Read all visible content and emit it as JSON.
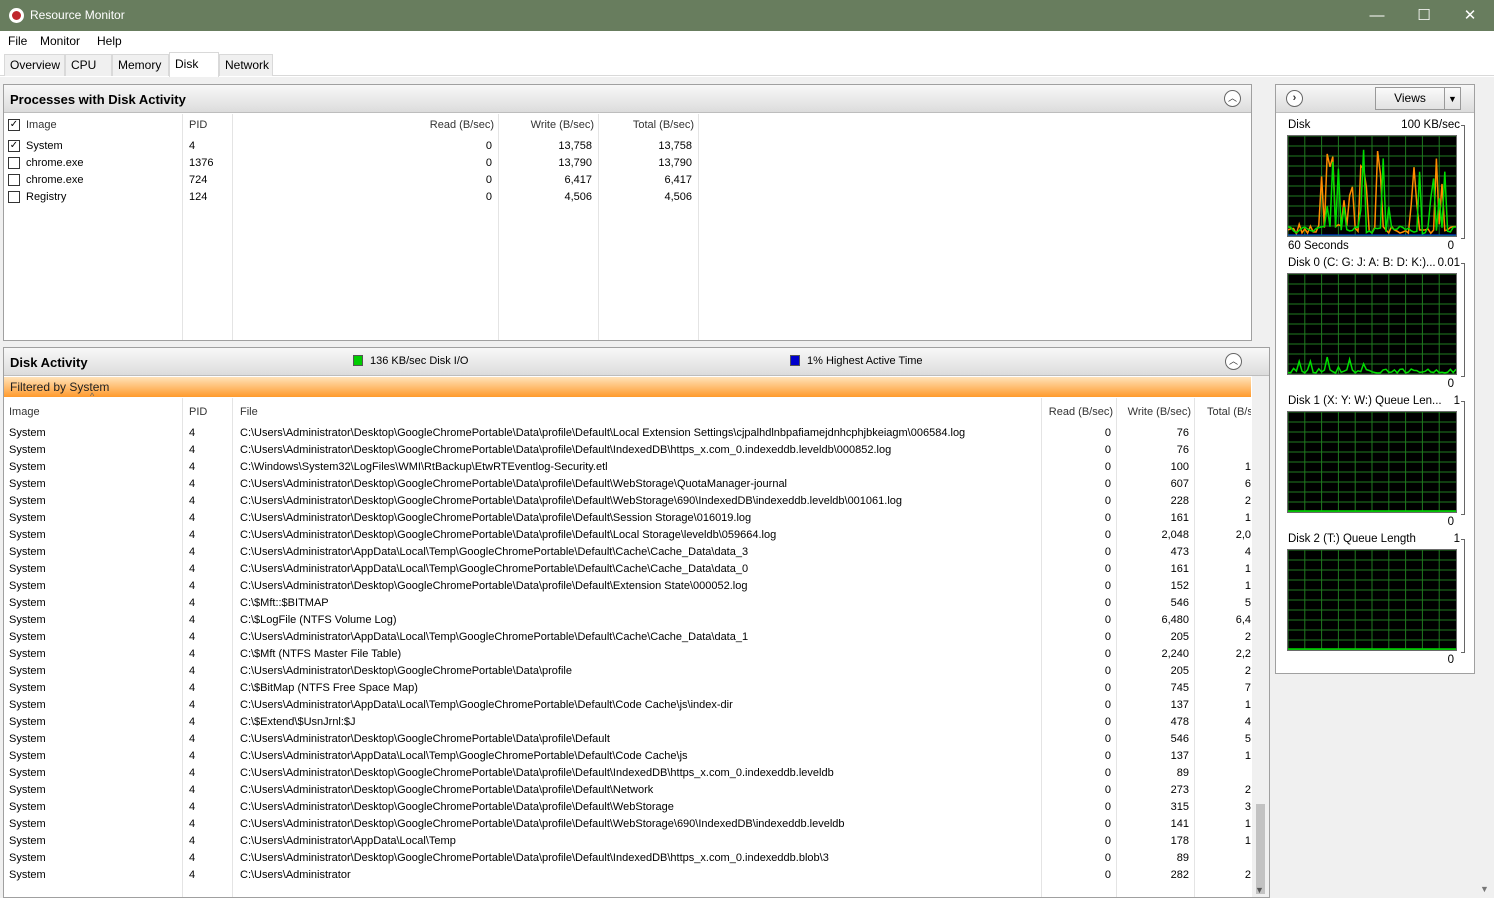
{
  "window": {
    "title": "Resource Monitor",
    "minimize": "—",
    "maximize": "☐",
    "close": "✕"
  },
  "menu": [
    "File",
    "Monitor",
    "Help"
  ],
  "tabs": [
    "Overview",
    "CPU",
    "Memory",
    "Disk",
    "Network"
  ],
  "active_tab": "Disk",
  "processes": {
    "title": "Processes with Disk Activity",
    "columns": {
      "image": "Image",
      "pid": "PID",
      "read": "Read (B/sec)",
      "write": "Write (B/sec)",
      "total": "Total (B/sec)"
    },
    "rows": [
      {
        "checked": true,
        "image": "System",
        "pid": "4",
        "read": "0",
        "write": "13,758",
        "total": "13,758"
      },
      {
        "checked": false,
        "image": "chrome.exe",
        "pid": "1376",
        "read": "0",
        "write": "13,790",
        "total": "13,790"
      },
      {
        "checked": false,
        "image": "chrome.exe",
        "pid": "724",
        "read": "0",
        "write": "6,417",
        "total": "6,417"
      },
      {
        "checked": false,
        "image": "Registry",
        "pid": "124",
        "read": "0",
        "write": "4,506",
        "total": "4,506"
      }
    ]
  },
  "disk_activity": {
    "title": "Disk Activity",
    "io_label": "136 KB/sec Disk I/O",
    "active_label": "1% Highest Active Time",
    "io_color": "#00cc00",
    "active_color": "#0000cc",
    "filter": "Filtered by System",
    "columns": {
      "image": "Image",
      "pid": "PID",
      "file": "File",
      "read": "Read (B/sec)",
      "write": "Write (B/sec)",
      "total": "Total (B/s"
    },
    "rows": [
      {
        "image": "System",
        "pid": "4",
        "file": "C:\\Users\\Administrator\\Desktop\\GoogleChromePortable\\Data\\profile\\Default\\Local Extension Settings\\cjpalhdlnbpafiamejdnhcphjbkeiagm\\006584.log",
        "read": "0",
        "write": "76",
        "total": ""
      },
      {
        "image": "System",
        "pid": "4",
        "file": "C:\\Users\\Administrator\\Desktop\\GoogleChromePortable\\Data\\profile\\Default\\IndexedDB\\https_x.com_0.indexeddb.leveldb\\000852.log",
        "read": "0",
        "write": "76",
        "total": ""
      },
      {
        "image": "System",
        "pid": "4",
        "file": "C:\\Windows\\System32\\LogFiles\\WMI\\RtBackup\\EtwRTEventlog-Security.etl",
        "read": "0",
        "write": "100",
        "total": "1"
      },
      {
        "image": "System",
        "pid": "4",
        "file": "C:\\Users\\Administrator\\Desktop\\GoogleChromePortable\\Data\\profile\\Default\\WebStorage\\QuotaManager-journal",
        "read": "0",
        "write": "607",
        "total": "6"
      },
      {
        "image": "System",
        "pid": "4",
        "file": "C:\\Users\\Administrator\\Desktop\\GoogleChromePortable\\Data\\profile\\Default\\WebStorage\\690\\IndexedDB\\indexeddb.leveldb\\001061.log",
        "read": "0",
        "write": "228",
        "total": "2"
      },
      {
        "image": "System",
        "pid": "4",
        "file": "C:\\Users\\Administrator\\Desktop\\GoogleChromePortable\\Data\\profile\\Default\\Session Storage\\016019.log",
        "read": "0",
        "write": "161",
        "total": "1"
      },
      {
        "image": "System",
        "pid": "4",
        "file": "C:\\Users\\Administrator\\Desktop\\GoogleChromePortable\\Data\\profile\\Default\\Local Storage\\leveldb\\059664.log",
        "read": "0",
        "write": "2,048",
        "total": "2,0"
      },
      {
        "image": "System",
        "pid": "4",
        "file": "C:\\Users\\Administrator\\AppData\\Local\\Temp\\GoogleChromePortable\\Default\\Cache\\Cache_Data\\data_3",
        "read": "0",
        "write": "473",
        "total": "4"
      },
      {
        "image": "System",
        "pid": "4",
        "file": "C:\\Users\\Administrator\\AppData\\Local\\Temp\\GoogleChromePortable\\Default\\Cache\\Cache_Data\\data_0",
        "read": "0",
        "write": "161",
        "total": "1"
      },
      {
        "image": "System",
        "pid": "4",
        "file": "C:\\Users\\Administrator\\Desktop\\GoogleChromePortable\\Data\\profile\\Default\\Extension State\\000052.log",
        "read": "0",
        "write": "152",
        "total": "1"
      },
      {
        "image": "System",
        "pid": "4",
        "file": "C:\\$Mft::$BITMAP",
        "read": "0",
        "write": "546",
        "total": "5"
      },
      {
        "image": "System",
        "pid": "4",
        "file": "C:\\$LogFile (NTFS Volume Log)",
        "read": "0",
        "write": "6,480",
        "total": "6,4"
      },
      {
        "image": "System",
        "pid": "4",
        "file": "C:\\Users\\Administrator\\AppData\\Local\\Temp\\GoogleChromePortable\\Default\\Cache\\Cache_Data\\data_1",
        "read": "0",
        "write": "205",
        "total": "2"
      },
      {
        "image": "System",
        "pid": "4",
        "file": "C:\\$Mft (NTFS Master File Table)",
        "read": "0",
        "write": "2,240",
        "total": "2,2"
      },
      {
        "image": "System",
        "pid": "4",
        "file": "C:\\Users\\Administrator\\Desktop\\GoogleChromePortable\\Data\\profile",
        "read": "0",
        "write": "205",
        "total": "2"
      },
      {
        "image": "System",
        "pid": "4",
        "file": "C:\\$BitMap (NTFS Free Space Map)",
        "read": "0",
        "write": "745",
        "total": "7"
      },
      {
        "image": "System",
        "pid": "4",
        "file": "C:\\Users\\Administrator\\AppData\\Local\\Temp\\GoogleChromePortable\\Default\\Code Cache\\js\\index-dir",
        "read": "0",
        "write": "137",
        "total": "1"
      },
      {
        "image": "System",
        "pid": "4",
        "file": "C:\\$Extend\\$UsnJrnl:$J",
        "read": "0",
        "write": "478",
        "total": "4"
      },
      {
        "image": "System",
        "pid": "4",
        "file": "C:\\Users\\Administrator\\Desktop\\GoogleChromePortable\\Data\\profile\\Default",
        "read": "0",
        "write": "546",
        "total": "5"
      },
      {
        "image": "System",
        "pid": "4",
        "file": "C:\\Users\\Administrator\\AppData\\Local\\Temp\\GoogleChromePortable\\Default\\Code Cache\\js",
        "read": "0",
        "write": "137",
        "total": "1"
      },
      {
        "image": "System",
        "pid": "4",
        "file": "C:\\Users\\Administrator\\Desktop\\GoogleChromePortable\\Data\\profile\\Default\\IndexedDB\\https_x.com_0.indexeddb.leveldb",
        "read": "0",
        "write": "89",
        "total": ""
      },
      {
        "image": "System",
        "pid": "4",
        "file": "C:\\Users\\Administrator\\Desktop\\GoogleChromePortable\\Data\\profile\\Default\\Network",
        "read": "0",
        "write": "273",
        "total": "2"
      },
      {
        "image": "System",
        "pid": "4",
        "file": "C:\\Users\\Administrator\\Desktop\\GoogleChromePortable\\Data\\profile\\Default\\WebStorage",
        "read": "0",
        "write": "315",
        "total": "3"
      },
      {
        "image": "System",
        "pid": "4",
        "file": "C:\\Users\\Administrator\\Desktop\\GoogleChromePortable\\Data\\profile\\Default\\WebStorage\\690\\IndexedDB\\indexeddb.leveldb",
        "read": "0",
        "write": "141",
        "total": "1"
      },
      {
        "image": "System",
        "pid": "4",
        "file": "C:\\Users\\Administrator\\AppData\\Local\\Temp",
        "read": "0",
        "write": "178",
        "total": "1"
      },
      {
        "image": "System",
        "pid": "4",
        "file": "C:\\Users\\Administrator\\Desktop\\GoogleChromePortable\\Data\\profile\\Default\\IndexedDB\\https_x.com_0.indexeddb.blob\\3",
        "read": "0",
        "write": "89",
        "total": ""
      },
      {
        "image": "System",
        "pid": "4",
        "file": "C:\\Users\\Administrator",
        "read": "0",
        "write": "282",
        "total": "2"
      }
    ]
  },
  "side": {
    "views_label": "Views",
    "expand_icon": "chevron-right-icon",
    "graphs": [
      {
        "name": "Disk",
        "max": "100 KB/sec",
        "footer_left": "60 Seconds",
        "footer_right": "0",
        "type": "disk"
      },
      {
        "name": "Disk 0 (C: G: J: A: B: D: K:)...",
        "max": "0.01",
        "footer_left": "",
        "footer_right": "0",
        "type": "disk0"
      },
      {
        "name": "Disk 1 (X: Y: W:) Queue Len...",
        "max": "1",
        "footer_left": "",
        "footer_right": "0",
        "type": "flat"
      },
      {
        "name": "Disk 2 (T:) Queue Length",
        "max": "1",
        "footer_left": "",
        "footer_right": "0",
        "type": "flat"
      }
    ]
  }
}
